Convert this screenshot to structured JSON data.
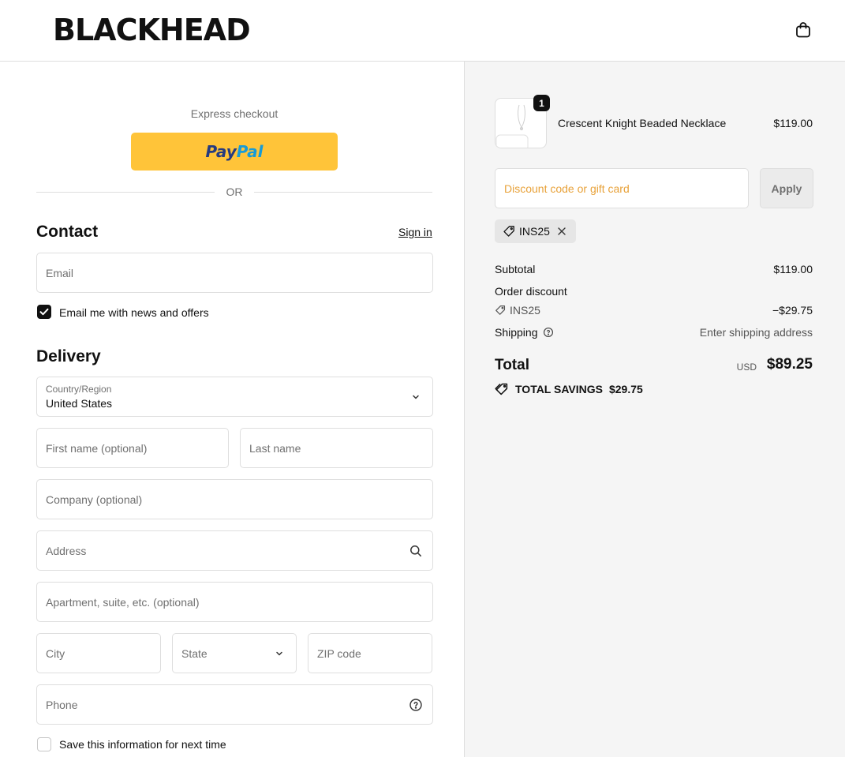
{
  "header": {
    "logo": "BLACKHEAD",
    "cart_icon": "shopping-bag-icon"
  },
  "express": {
    "label": "Express checkout",
    "paypal_part1": "Pay",
    "paypal_part2": "Pal",
    "paypal_color": "#ffc439",
    "divider_text": "OR"
  },
  "contact": {
    "heading": "Contact",
    "sign_in": "Sign in",
    "email_placeholder": "Email",
    "newsletter_label": "Email me with news and offers",
    "newsletter_checked": true
  },
  "delivery": {
    "heading": "Delivery",
    "country_label": "Country/Region",
    "country_value": "United States",
    "first_name_placeholder": "First name (optional)",
    "last_name_placeholder": "Last name",
    "company_placeholder": "Company (optional)",
    "address_placeholder": "Address",
    "apartment_placeholder": "Apartment, suite, etc. (optional)",
    "city_placeholder": "City",
    "state_placeholder": "State",
    "zip_placeholder": "ZIP code",
    "phone_placeholder": "Phone",
    "save_info_label": "Save this information for next time",
    "save_info_checked": false
  },
  "summary": {
    "product": {
      "quantity": "1",
      "name": "Crescent Knight Beaded Necklace",
      "price": "$119.00"
    },
    "discount_placeholder": "Discount code or gift card",
    "apply_label": "Apply",
    "applied_code": "INS25",
    "subtotal_label": "Subtotal",
    "subtotal_value": "$119.00",
    "order_discount_label": "Order discount",
    "discount_code": "INS25",
    "discount_value": "−$29.75",
    "shipping_label": "Shipping",
    "shipping_value": "Enter shipping address",
    "total_label": "Total",
    "total_currency": "USD",
    "total_value": "$89.25",
    "savings_label": "TOTAL SAVINGS",
    "savings_value": "$29.75"
  }
}
